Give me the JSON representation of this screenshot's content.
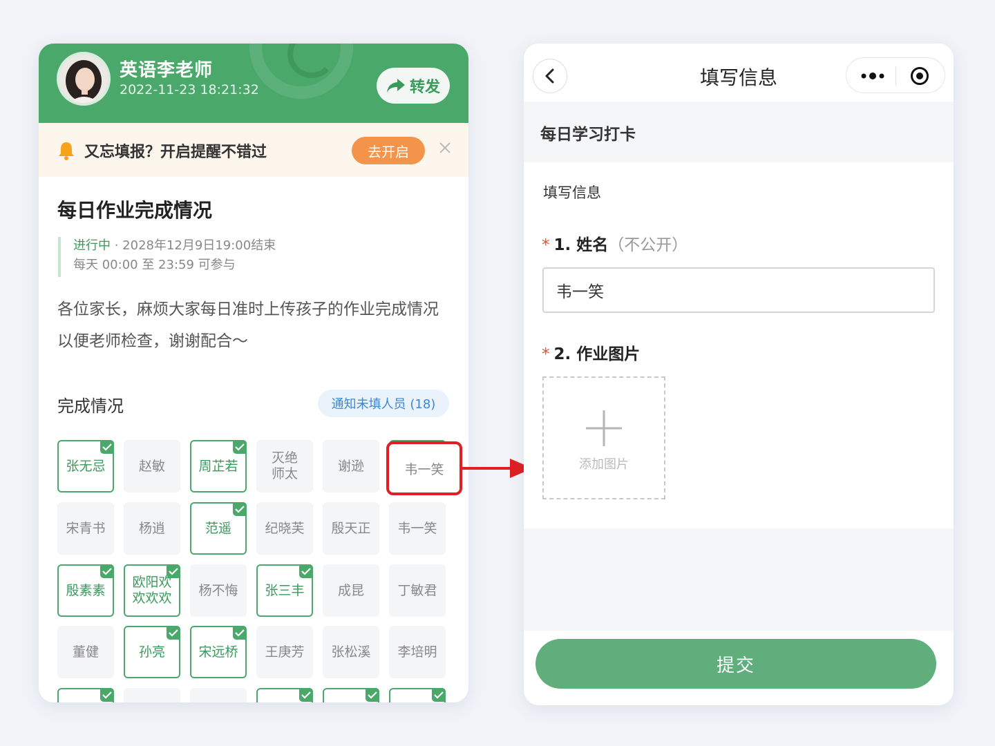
{
  "left": {
    "teacher_name": "英语李老师",
    "post_time": "2022-11-23 18:21:32",
    "share_label": "转发",
    "reminder_text": "又忘填报？开启提醒不错过",
    "enable_label": "去开启",
    "task_title": "每日作业完成情况",
    "status": "进行中",
    "deadline": " · 2028年12月9日19:00结束",
    "schedule": "每天 00:00 至 23:59 可参与",
    "description": "各位家长，麻烦大家每日准时上传孩子的作业完成情况以便老师检查，谢谢配合～",
    "progress_title": "完成情况",
    "notify_label": "通知未填人员 (18)",
    "students": [
      {
        "name": "张无忌",
        "done": true
      },
      {
        "name": "赵敏",
        "done": false
      },
      {
        "name": "周芷若",
        "done": true
      },
      {
        "name": "灭绝\n师太",
        "done": false
      },
      {
        "name": "谢逊",
        "done": false
      },
      {
        "name": "韦一笑",
        "done": true
      },
      {
        "name": "宋青书",
        "done": false
      },
      {
        "name": "杨逍",
        "done": false
      },
      {
        "name": "范遥",
        "done": true
      },
      {
        "name": "纪晓芙",
        "done": false
      },
      {
        "name": "殷天正",
        "done": false
      },
      {
        "name": "韦一笑",
        "done": false
      },
      {
        "name": "殷素素",
        "done": true
      },
      {
        "name": "欧阳欢\n欢欢欢",
        "done": true
      },
      {
        "name": "杨不悔",
        "done": false
      },
      {
        "name": "张三丰",
        "done": true
      },
      {
        "name": "成昆",
        "done": false
      },
      {
        "name": "丁敏君",
        "done": false
      },
      {
        "name": "董健",
        "done": false
      },
      {
        "name": "孙亮",
        "done": true
      },
      {
        "name": "宋远桥",
        "done": true
      },
      {
        "name": "王庚芳",
        "done": false
      },
      {
        "name": "张松溪",
        "done": false
      },
      {
        "name": "李培明",
        "done": false
      },
      {
        "name": "",
        "done": true
      },
      {
        "name": "",
        "done": false
      },
      {
        "name": "",
        "done": false
      },
      {
        "name": "",
        "done": true
      },
      {
        "name": "",
        "done": true
      },
      {
        "name": "",
        "done": true
      }
    ],
    "highlighted_name": "韦一笑"
  },
  "right": {
    "nav_title": "填写信息",
    "section_head": "每日学习打卡",
    "form_sub": "填写信息",
    "q1_number": "1. 姓名",
    "q1_hint": "（不公开）",
    "q1_value": "韦一笑",
    "q2_number": "2. 作业图片",
    "upload_label": "添加图片",
    "submit_label": "提交"
  },
  "colors": {
    "brand_green": "#4aa86a",
    "submit_green": "#5fae7b",
    "orange": "#f4934a",
    "highlight_red": "#e01e24"
  }
}
